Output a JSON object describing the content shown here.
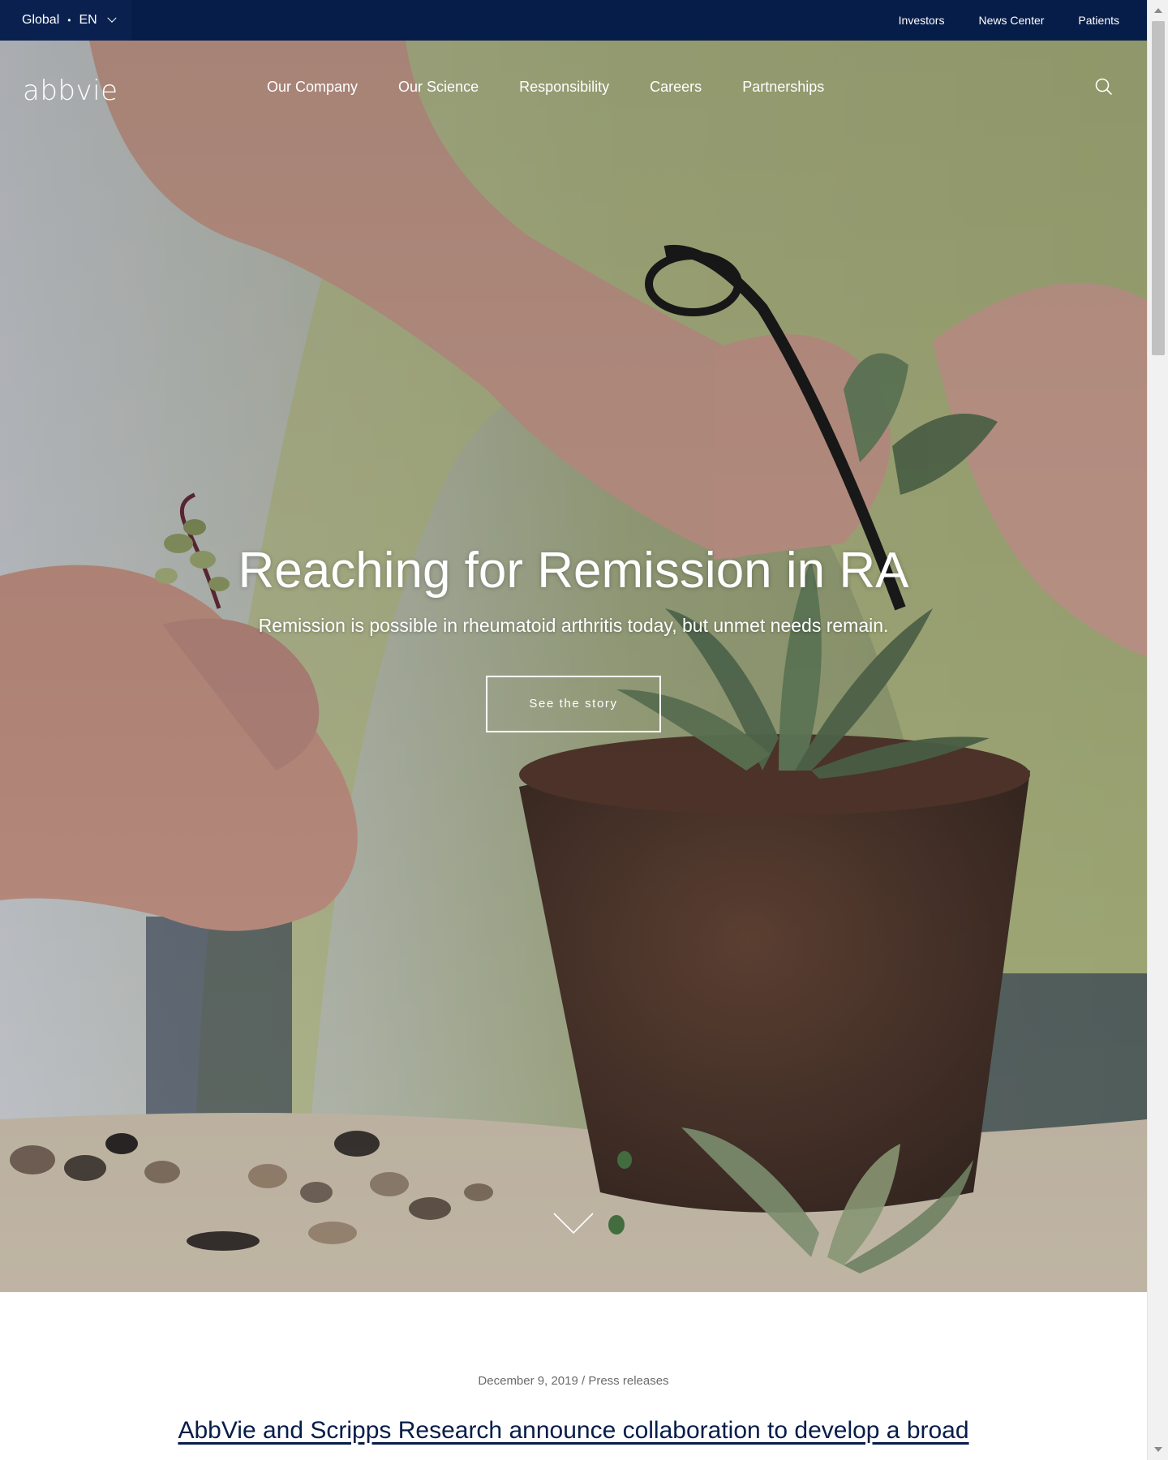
{
  "utility_bar": {
    "locale": {
      "region": "Global",
      "separator": "•",
      "language": "EN"
    },
    "links": [
      "Investors",
      "News Center",
      "Patients"
    ]
  },
  "header": {
    "logo": "abbvie",
    "nav": [
      "Our Company",
      "Our Science",
      "Responsibility",
      "Careers",
      "Partnerships"
    ],
    "search_icon": "search-icon"
  },
  "hero": {
    "title": "Reaching for Remission in RA",
    "subtitle": "Remission is possible in rheumatoid arthritis today, but unmet needs remain.",
    "cta_label": "See the story",
    "scroll_icon": "chevron-down-icon"
  },
  "news": {
    "date": "December 9, 2019",
    "divider": "/",
    "category": "Press releases",
    "headline": "AbbVie and Scripps Research announce collaboration to develop a broad"
  },
  "colors": {
    "navy": "#071d49",
    "white": "#ffffff",
    "meta_gray": "#6b6b6b"
  }
}
